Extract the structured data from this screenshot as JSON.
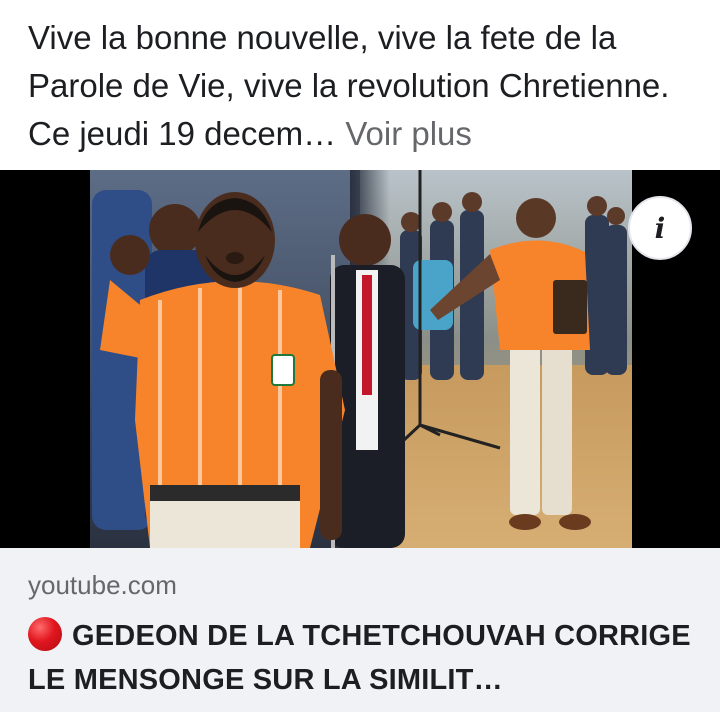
{
  "post": {
    "text": "Vive la bonne nouvelle, vive la fete de la Parole de Vie, vive la revolution Chretienne. Ce jeudi 19 decem…",
    "see_more_label": "Voir plus"
  },
  "media": {
    "info_icon": "info-icon",
    "info_glyph": "i"
  },
  "link_preview": {
    "domain": "youtube.com",
    "title_icon": "red-circle-icon",
    "title": "GEDEON DE LA TCHETCHOUVAH CORRIGE LE MENSONGE SUR LA SIMILIT…"
  },
  "colors": {
    "text": "#1c1e21",
    "secondary_text": "#65676b",
    "card_background": "#f0f2f5",
    "jersey_orange": "#f7842a",
    "live_red": "#e0161f"
  }
}
